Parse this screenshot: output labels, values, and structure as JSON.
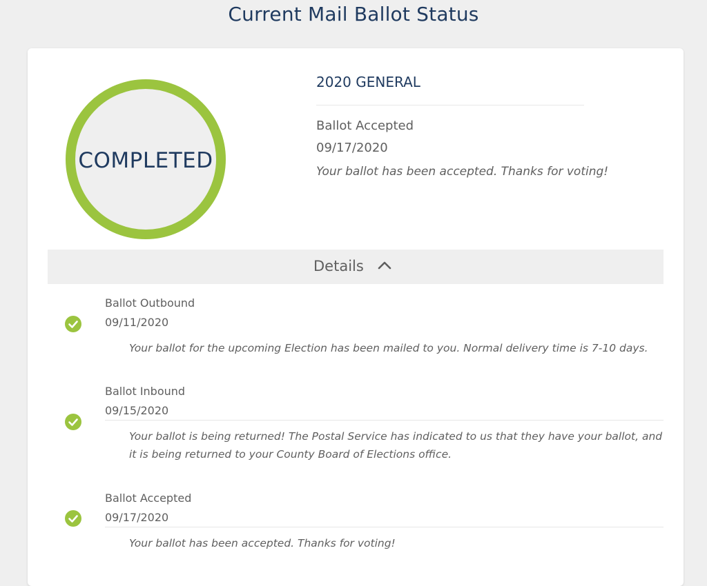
{
  "page": {
    "title": "Current Mail Ballot Status"
  },
  "status": {
    "label": "COMPLETED",
    "ring_color": "#9bc43f"
  },
  "summary": {
    "election": "2020 GENERAL",
    "status": "Ballot Accepted",
    "date": "09/17/2020",
    "message": "Your ballot has been accepted. Thanks for voting!"
  },
  "details": {
    "label": "Details",
    "toggle_icon": "chevron-up-icon",
    "events": [
      {
        "status": "Ballot Outbound",
        "date": "09/11/2020",
        "message": "Your ballot for the upcoming Election has been mailed to you. Normal delivery time is 7-10 days.",
        "icon": "check-circle-icon"
      },
      {
        "status": "Ballot Inbound",
        "date": "09/15/2020",
        "message": "Your ballot is being returned! The Postal Service has indicated to us that they have your ballot, and it is being returned to your County Board of Elections office.",
        "icon": "check-circle-icon"
      },
      {
        "status": "Ballot Accepted",
        "date": "09/17/2020",
        "message": "Your ballot has been accepted. Thanks for voting!",
        "icon": "check-circle-icon"
      }
    ]
  },
  "colors": {
    "accent_green": "#9bc43f",
    "navy": "#1f3a5f",
    "text_gray": "#5f5f5f",
    "background": "#efefef"
  }
}
